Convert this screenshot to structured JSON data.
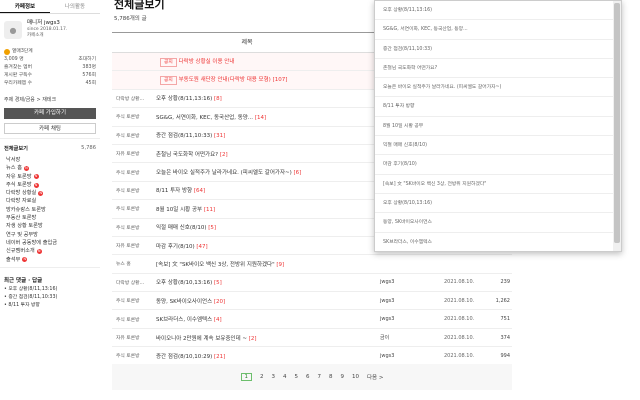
{
  "sidebar": {
    "tabs": [
      "카페정보",
      "나의활동"
    ],
    "profile": {
      "role": "매니저",
      "name": "jwgs3",
      "since": "since 2018.01.17.",
      "intro": "카페소개"
    },
    "level": "열매3단계",
    "members": "3,009 명",
    "invite": "초대하기",
    "stats": [
      {
        "label": "즐겨찾는 멤버",
        "value": "383명"
      },
      {
        "label": "게시판 구독수",
        "value": "576회"
      },
      {
        "label": "우리카페앱 수",
        "value": "45회"
      }
    ],
    "topic": "주제 경제/금융 > 재테크",
    "join_button": "카페 가입하기",
    "chat_button": "카페 채팅",
    "menu_title": "전체글보기",
    "menu_count": "5,786",
    "menu": [
      {
        "label": "낙서장",
        "new": false
      },
      {
        "label": "뉴스 홈",
        "new": true
      },
      {
        "label": "자유 토론방",
        "new": true
      },
      {
        "label": "주식 토론방",
        "new": true
      },
      {
        "label": "다락방 상황실",
        "new": true
      },
      {
        "label": "다락방 자료실",
        "new": false
      },
      {
        "label": "방카슈랑스 토론방",
        "new": false
      },
      {
        "label": "부동산 토론방",
        "new": false
      },
      {
        "label": "자생 상황 토론방",
        "new": false
      },
      {
        "label": "연구 및 공부방",
        "new": false
      },
      {
        "label": "네이버 공동방에 출입금",
        "new": false
      },
      {
        "label": "신규멤버소개",
        "new": true
      },
      {
        "label": "출석부",
        "new": true
      }
    ],
    "recent_title": "최근 댓글 · 답글",
    "recent": [
      "• 오후 상황(8/11,13:16)",
      "• 증간 점검(8/11,10:33)",
      "• 8/11 투자 방향"
    ]
  },
  "main": {
    "title": "전체글보기",
    "count": "5,786개의 글",
    "col_title": "제목",
    "rows": [
      {
        "cat": "",
        "notice": "공지",
        "subj": "다락방 상황실 이용 안내",
        "cm": "",
        "author": "",
        "date": "",
        "views": ""
      },
      {
        "cat": "",
        "notice": "공지",
        "subj": "부동도원 새단장 안내(다락방 대용 모형)",
        "cm": "[107]",
        "author": "",
        "date": "",
        "views": ""
      },
      {
        "cat": "다락방 상황...",
        "notice": "",
        "subj": "오후 상황(8/11,13:16)",
        "cm": "[8]",
        "author": "",
        "date": "",
        "views": ""
      },
      {
        "cat": "주식 토론방",
        "notice": "",
        "subj": "SG&G, 서연이화, KEC, 동국산업, 동양...",
        "cm": "[14]",
        "author": "",
        "date": "",
        "views": ""
      },
      {
        "cat": "주식 토론방",
        "notice": "",
        "subj": "증간 점검(8/11,10:33)",
        "cm": "[31]",
        "author": "",
        "date": "",
        "views": ""
      },
      {
        "cat": "자유 토론방",
        "notice": "",
        "subj": "촌철님 국도화학 어떤가요?",
        "cm": "[2]",
        "author": "",
        "date": "",
        "views": ""
      },
      {
        "cat": "주식 토론방",
        "notice": "",
        "subj": "오늘은 바이오 실적주가 날라가네요. (피씨엘도 갈어가자~)",
        "cm": "[6]",
        "author": "",
        "date": "",
        "views": ""
      },
      {
        "cat": "주식 토론방",
        "notice": "",
        "subj": "8/11 투자 방향",
        "cm": "[64]",
        "author": "",
        "date": "",
        "views": ""
      },
      {
        "cat": "주식 토론방",
        "notice": "",
        "subj": "8월 10일 시황 공부",
        "cm": "[11]",
        "author": "",
        "date": "",
        "views": ""
      },
      {
        "cat": "주식 토론방",
        "notice": "",
        "subj": "익절 매매 신호(8/10)",
        "cm": "[5]",
        "author": "",
        "date": "",
        "views": ""
      },
      {
        "cat": "자유 토론방",
        "notice": "",
        "subj": "마감 후기(8/10)",
        "cm": "[47]",
        "author": "",
        "date": "",
        "views": ""
      },
      {
        "cat": "뉴스 홈",
        "notice": "",
        "subj": "[속보] 文 \"SK바이오 백신 3상, 전방위 지원하겠다\"",
        "cm": "[9]",
        "author": "",
        "date": "",
        "views": ""
      },
      {
        "cat": "다락방 상황...",
        "notice": "",
        "subj": "오후 상황(8/10,13:16)",
        "cm": "[5]",
        "author": "jwgs3",
        "date": "2021.08.10.",
        "views": "239"
      },
      {
        "cat": "주식 토론방",
        "notice": "",
        "subj": "동양, SK바이오사이언스",
        "cm": "[20]",
        "author": "jwgs3",
        "date": "2021.08.10.",
        "views": "1,262"
      },
      {
        "cat": "주식 토론방",
        "notice": "",
        "subj": "SK브라더스, 이수엠텍스",
        "cm": "[4]",
        "author": "jwgs3",
        "date": "2021.08.10.",
        "views": "751"
      },
      {
        "cat": "자유 토론방",
        "notice": "",
        "subj": "바이오니아 2만원에 계속 보유중인데 ~",
        "cm": "[2]",
        "author": "금이",
        "date": "2021.08.10.",
        "views": "374"
      },
      {
        "cat": "주식 토론방",
        "notice": "",
        "subj": "증간 점검(8/10,10:29)",
        "cm": "[21]",
        "author": "jwgs3",
        "date": "2021.08.10.",
        "views": "994"
      }
    ],
    "pages": [
      "1",
      "2",
      "3",
      "4",
      "5",
      "6",
      "7",
      "8",
      "9",
      "10"
    ],
    "next": "다음 >"
  },
  "dropdown": {
    "items": [
      "오후 상황(8/11,13:16)",
      "SG&G, 서연이화, KEC, 동국산업, 동양...",
      "증간 점검(8/11,10:33)",
      "촌철님 국도화학 어떤가요?",
      "오늘은 바이오 실적주가 날라가네요. (피씨엘도 갈어가자~)",
      "8/11 투자 방향",
      "8월 10일 시황 공부",
      "익절 매매 신호(8/10)",
      "마감 후기(8/10)",
      "[속보] 文 \"SK바이오 백신 3상, 전방위 지원하겠다\"",
      "오후 상황(8/10,13:16)",
      "동양, SK바이오사이언스",
      "SK브라더스, 이수엠텍스",
      "바이오니아 2만원에 계속 보유중인데 ~"
    ]
  }
}
